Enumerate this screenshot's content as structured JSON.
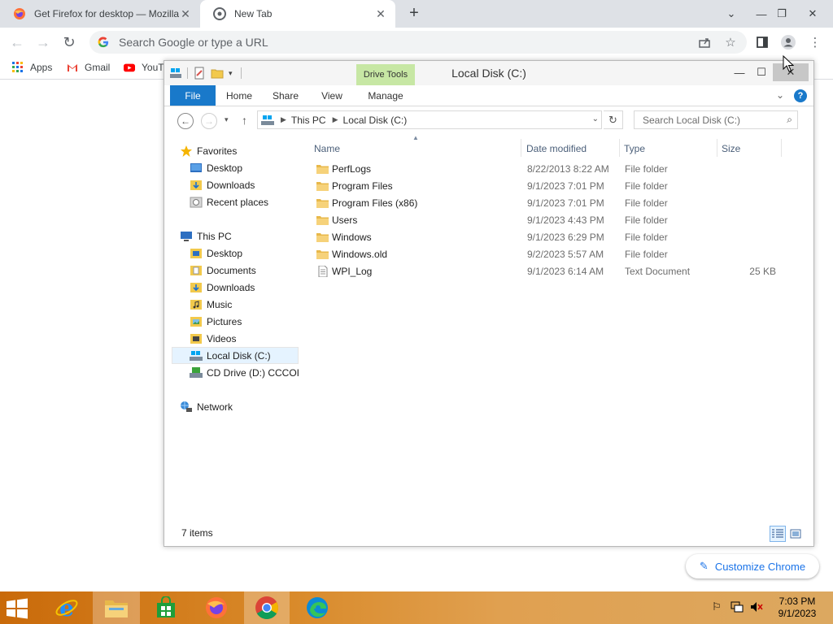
{
  "chrome": {
    "tabs": [
      {
        "title": "Get Firefox for desktop — Mozilla",
        "favicon": "firefox-icon"
      },
      {
        "title": "New Tab",
        "favicon": "chrome-newtab-icon"
      }
    ],
    "omnibox_placeholder": "Search Google or type a URL",
    "bookmarks": [
      {
        "label": "Apps",
        "icon": "apps-grid-icon"
      },
      {
        "label": "Gmail",
        "icon": "gmail-icon"
      },
      {
        "label": "YouT",
        "icon": "youtube-icon"
      }
    ],
    "customize_label": "Customize Chrome"
  },
  "explorer": {
    "title": "Local Disk (C:)",
    "context_tab": "Drive Tools",
    "ribbon_tabs": [
      "File",
      "Home",
      "Share",
      "View",
      "Manage"
    ],
    "address": {
      "segments": [
        "This PC",
        "Local Disk (C:)"
      ]
    },
    "search_placeholder": "Search Local Disk (C:)",
    "nav": {
      "favorites": "Favorites",
      "favorites_items": [
        "Desktop",
        "Downloads",
        "Recent places"
      ],
      "thispc": "This PC",
      "thispc_items": [
        "Desktop",
        "Documents",
        "Downloads",
        "Music",
        "Pictures",
        "Videos",
        "Local Disk (C:)",
        "CD Drive (D:) CCCOI"
      ],
      "network": "Network"
    },
    "columns": [
      "Name",
      "Date modified",
      "Type",
      "Size"
    ],
    "files": [
      {
        "name": "PerfLogs",
        "date": "8/22/2013 8:22 AM",
        "type": "File folder",
        "size": "",
        "icon": "folder-icon"
      },
      {
        "name": "Program Files",
        "date": "9/1/2023 7:01 PM",
        "type": "File folder",
        "size": "",
        "icon": "folder-icon"
      },
      {
        "name": "Program Files (x86)",
        "date": "9/1/2023 7:01 PM",
        "type": "File folder",
        "size": "",
        "icon": "folder-icon"
      },
      {
        "name": "Users",
        "date": "9/1/2023 4:43 PM",
        "type": "File folder",
        "size": "",
        "icon": "folder-icon"
      },
      {
        "name": "Windows",
        "date": "9/1/2023 6:29 PM",
        "type": "File folder",
        "size": "",
        "icon": "folder-icon"
      },
      {
        "name": "Windows.old",
        "date": "9/2/2023 5:57 AM",
        "type": "File folder",
        "size": "",
        "icon": "folder-icon"
      },
      {
        "name": "WPI_Log",
        "date": "9/1/2023 6:14 AM",
        "type": "Text Document",
        "size": "25 KB",
        "icon": "text-document-icon"
      }
    ],
    "status_count": "7 items"
  },
  "taskbar": {
    "apps": [
      "start-icon",
      "internet-explorer-icon",
      "file-explorer-icon",
      "store-icon",
      "firefox-icon",
      "chrome-icon",
      "edge-icon"
    ],
    "active_app": "chrome-icon",
    "clock_time": "7:03 PM",
    "clock_date": "9/1/2023"
  },
  "colors": {
    "ribbon_file": "#1979ca",
    "drive_tools": "#c7e7a4",
    "chrome_link": "#1a73e8",
    "taskbar": "#d98a2a"
  }
}
